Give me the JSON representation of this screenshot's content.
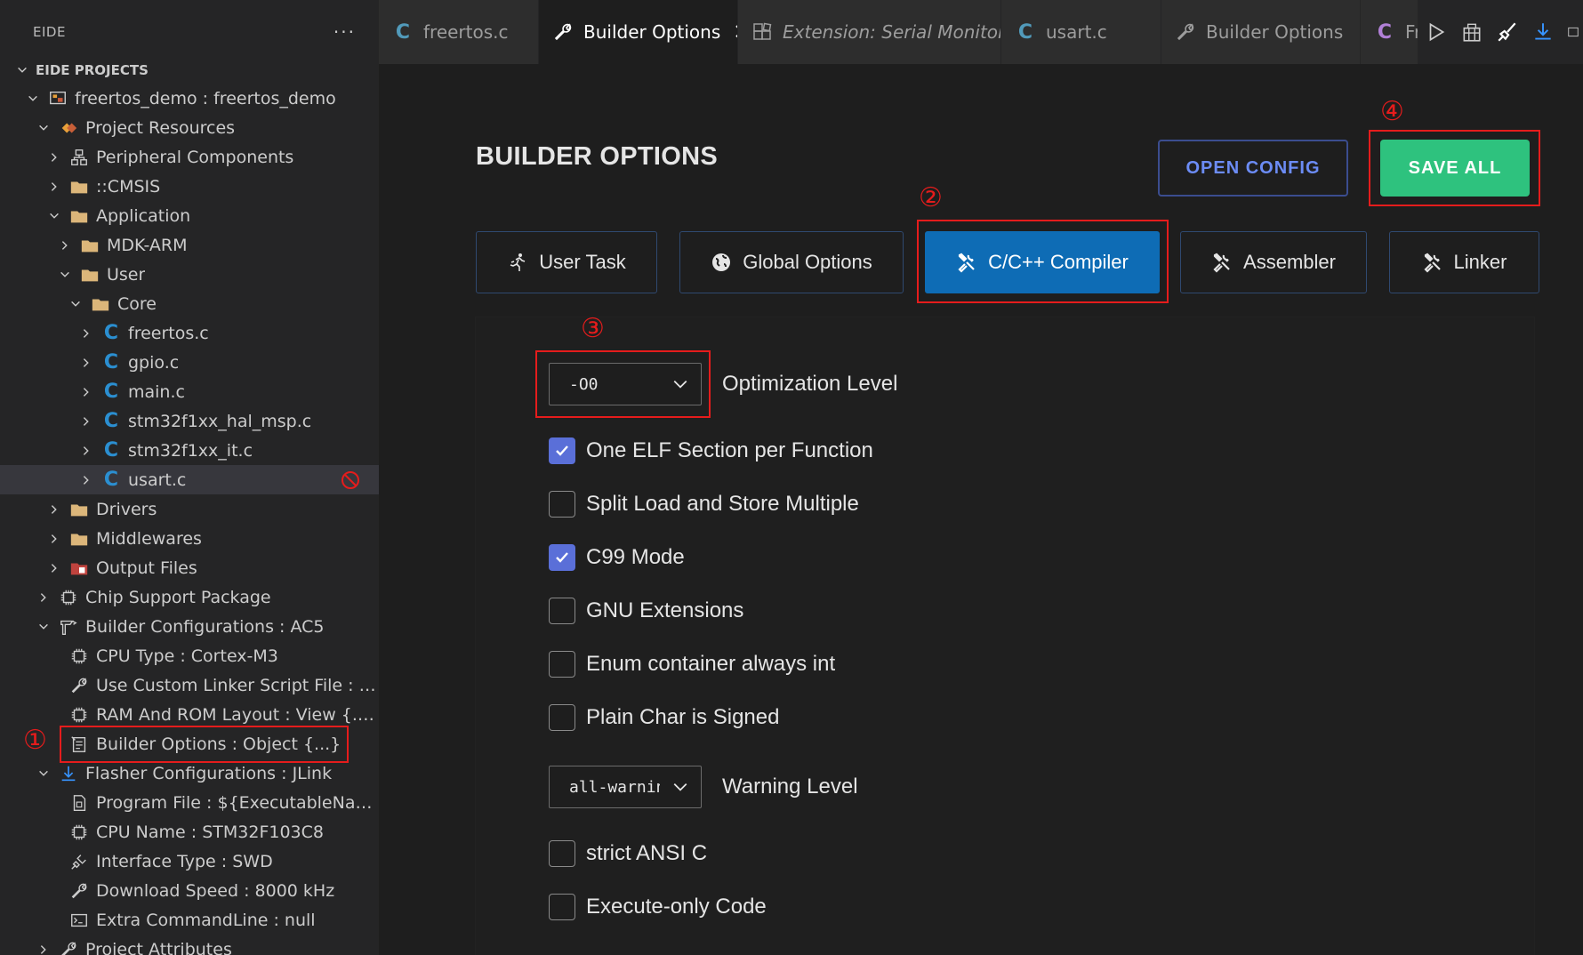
{
  "sidebar": {
    "title": "EIDE",
    "more": "···",
    "section": "EIDE PROJECTS",
    "rows": [
      {
        "label": "freertos_demo : freertos_demo",
        "icon": "project-icon"
      },
      {
        "label": "Project Resources",
        "icon": "resources-icon"
      },
      {
        "label": "Peripheral Components",
        "icon": "components-icon"
      },
      {
        "label": "::CMSIS",
        "icon": "folder-icon"
      },
      {
        "label": "Application",
        "icon": "folder-icon"
      },
      {
        "label": "MDK-ARM",
        "icon": "folder-icon"
      },
      {
        "label": "User",
        "icon": "folder-icon"
      },
      {
        "label": "Core",
        "icon": "folder-icon"
      },
      {
        "label": "freertos.c",
        "icon": "c-file-icon"
      },
      {
        "label": "gpio.c",
        "icon": "c-file-icon"
      },
      {
        "label": "main.c",
        "icon": "c-file-icon"
      },
      {
        "label": "stm32f1xx_hal_msp.c",
        "icon": "c-file-icon"
      },
      {
        "label": "stm32f1xx_it.c",
        "icon": "c-file-icon"
      },
      {
        "label": "usart.c",
        "icon": "c-file-icon"
      },
      {
        "label": "Drivers",
        "icon": "folder-icon"
      },
      {
        "label": "Middlewares",
        "icon": "folder-icon"
      },
      {
        "label": "Output Files",
        "icon": "output-folder-icon"
      },
      {
        "label": "Chip Support Package",
        "icon": "chip-icon"
      },
      {
        "label": "Builder Configurations : AC5",
        "icon": "builder-icon"
      },
      {
        "label": "CPU Type : Cortex-M3",
        "icon": "chip-icon"
      },
      {
        "label": "Use Custom Linker Script File : f...",
        "icon": "wrench-icon"
      },
      {
        "label": "RAM And ROM Layout : View {...}",
        "icon": "chip-icon"
      },
      {
        "label": "Builder Options : Object {...}",
        "icon": "options-icon"
      },
      {
        "label": "Flasher Configurations : JLink",
        "icon": "download-icon"
      },
      {
        "label": "Program File : ${ExecutableNam...",
        "icon": "file-icon"
      },
      {
        "label": "CPU Name : STM32F103C8",
        "icon": "chip-icon"
      },
      {
        "label": "Interface Type : SWD",
        "icon": "plug-icon"
      },
      {
        "label": "Download Speed : 8000 kHz",
        "icon": "wrench-icon"
      },
      {
        "label": "Extra CommandLine : null",
        "icon": "terminal-icon"
      },
      {
        "label": "Project Attributes",
        "icon": "wrench-icon"
      }
    ]
  },
  "annotations": [
    "①",
    "②",
    "③",
    "④"
  ],
  "tabs": [
    {
      "label": "freertos.c",
      "icon": "c-file-icon"
    },
    {
      "label": "Builder Options",
      "icon": "wrench-icon",
      "close": "✕"
    },
    {
      "label": "Extension: Serial Monitor",
      "icon": "extension-icon"
    },
    {
      "label": "usart.c",
      "icon": "c-file-icon"
    },
    {
      "label": "Builder Options",
      "icon": "wrench-icon"
    },
    {
      "label": "Fre",
      "icon": "c-file-icon"
    }
  ],
  "page": {
    "title": "BUILDER OPTIONS",
    "open_config": "OPEN CONFIG",
    "save_all": "SAVE ALL",
    "option_tabs": [
      "User Task",
      "Global Options",
      "C/C++ Compiler",
      "Assembler",
      "Linker"
    ],
    "optimization": {
      "value": "-O0",
      "label": "Optimization Level"
    },
    "checkboxes": [
      {
        "label": "One ELF Section per Function",
        "checked": true
      },
      {
        "label": "Split Load and Store Multiple",
        "checked": false
      },
      {
        "label": "C99 Mode",
        "checked": true
      },
      {
        "label": "GNU Extensions",
        "checked": false
      },
      {
        "label": "Enum container always int",
        "checked": false
      },
      {
        "label": "Plain Char is Signed",
        "checked": false
      }
    ],
    "warning": {
      "value": "all-warnings",
      "label": "Warning Level"
    },
    "checkboxes2": [
      {
        "label": "strict ANSI C",
        "checked": false
      },
      {
        "label": "Execute-only Code",
        "checked": false
      }
    ]
  },
  "colors": {
    "accent": "#0e6cb5",
    "save": "#2ec27e",
    "annotation": "#e51c1c",
    "checkbox_on": "#5a6fd8"
  }
}
